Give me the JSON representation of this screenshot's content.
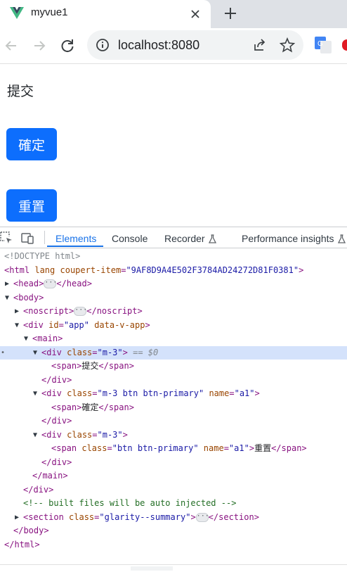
{
  "browser": {
    "tab_title": "myvue1",
    "address": "localhost:8080"
  },
  "page": {
    "text": "提交",
    "confirm_button": "確定",
    "reset_button": "重置"
  },
  "devtools": {
    "tabs": [
      "Elements",
      "Console",
      "Recorder",
      "Performance insights"
    ],
    "active_tab": "Elements",
    "dom": {
      "doctype": "<!DOCTYPE html>",
      "html_open_tag": "<html",
      "html_lang_attr": "lang",
      "html_coupert_attr": "coupert-item",
      "html_coupert_value": "\"9AF8D9A4E502F3784AD24272D81F0381\"",
      "head_open": "<head>",
      "head_close": "</head>",
      "body_open": "<body>",
      "noscript_open": "<noscript>",
      "noscript_close": "</noscript>",
      "div_open": "<div",
      "id_attr": "id",
      "app_value": "\"app\"",
      "data_v_app_attr": "data-v-app",
      "main_open": "<main>",
      "class_attr": "class",
      "m3_value": "\"m-3\"",
      "dollar0": "== $0",
      "span_open": "<span>",
      "span_tag_open": "<span",
      "span_close": "</span>",
      "text_submit": "提交",
      "text_confirm": "確定",
      "text_reset": "重置",
      "div_close": "</div>",
      "m3_btn_value": "\"m-3 btn btn-primary\"",
      "name_attr": "name",
      "a1_value": "\"a1\"",
      "btn_value": "\"btn btn-primary\"",
      "main_close": "</main>",
      "comment": "<!-- built files will be auto injected -->",
      "section_open": "<section",
      "glarity_value": "\"glarity--summary\"",
      "section_close": "</section>",
      "body_close": "</body>",
      "html_close": "</html>"
    }
  },
  "colors": {
    "primary": "#0d6efd",
    "devtools_accent": "#1a73e8",
    "selected_row": "#d4e2fb",
    "tag": "#881280",
    "attr_name": "#994500",
    "attr_value": "#1a1aa6",
    "comment": "#236e25"
  }
}
